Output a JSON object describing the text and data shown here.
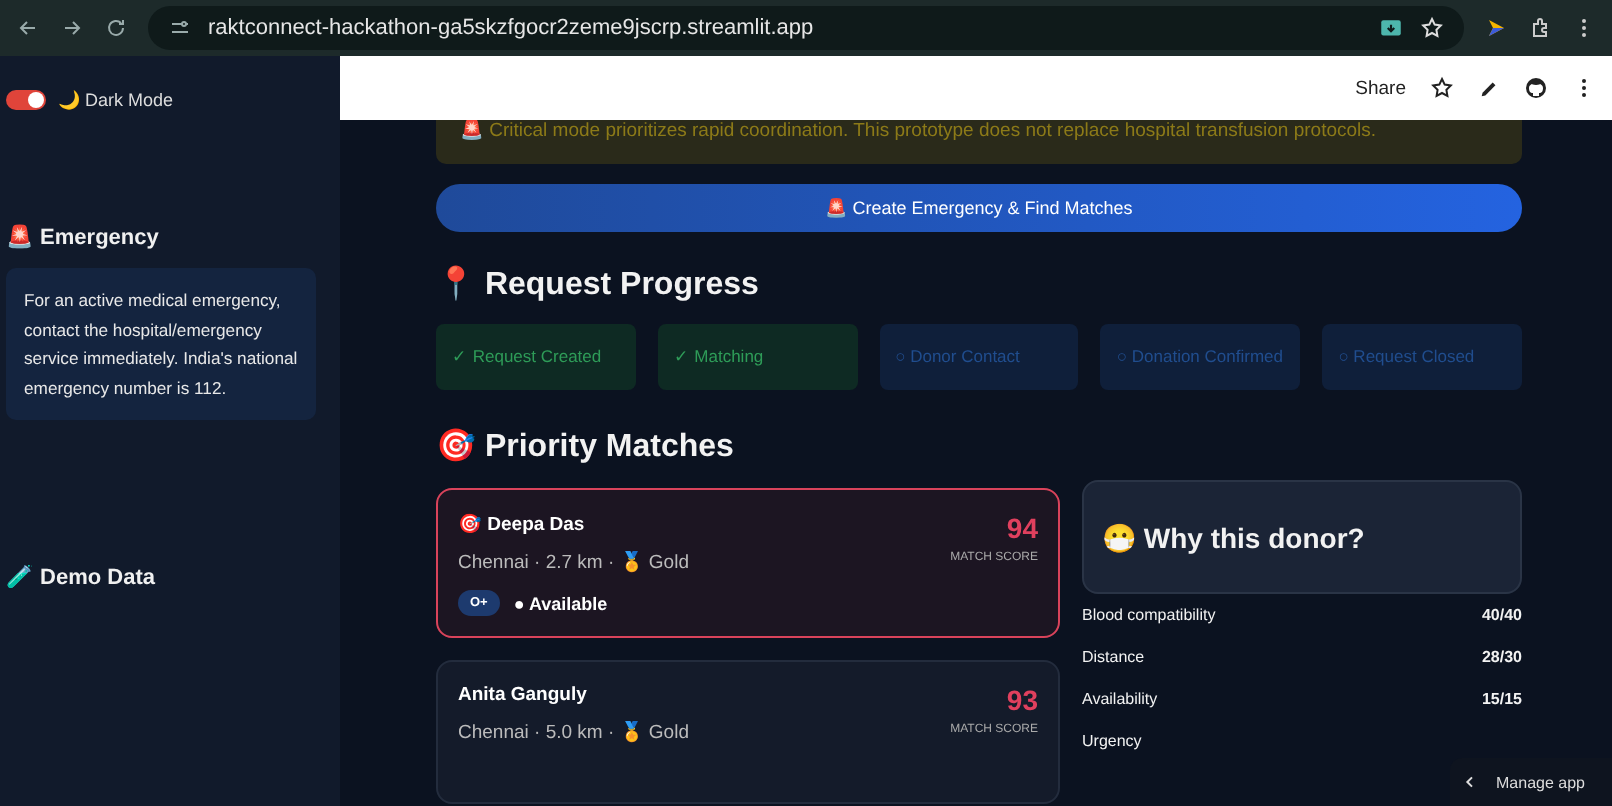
{
  "browser": {
    "url": "raktconnect-hackathon-ga5skzfgocr2zeme9jscrp.streamlit.app"
  },
  "sidebar": {
    "dark_mode": {
      "label": "🌙 Dark Mode",
      "on": true
    },
    "sections": [
      {
        "title": "🚨 Emergency",
        "note": "For an active medical emergency, contact the hospital/emergency service immediately. India's national emergency number is 112."
      },
      {
        "title": "🧪 Demo Data"
      }
    ]
  },
  "header": {
    "share": "Share"
  },
  "warning": "🚨 Critical mode prioritizes rapid coordination. This prototype does not replace hospital transfusion protocols.",
  "primary_button": "🚨 Create Emergency & Find Matches",
  "progress": {
    "title": "📍 Request Progress",
    "steps": [
      {
        "label": "✓ Request Created",
        "done": true
      },
      {
        "label": "✓ Matching",
        "done": true
      },
      {
        "label": "○ Donor Contact",
        "done": false
      },
      {
        "label": "○ Donation Confirmed",
        "done": false
      },
      {
        "label": "○ Request Closed",
        "done": false
      }
    ]
  },
  "matches": {
    "title": "🎯 Priority Matches",
    "donors": [
      {
        "name": "🎯 Deepa Das",
        "location": "Chennai · 2.7 km · 🏅 Gold",
        "score": "94",
        "score_label": "MATCH SCORE",
        "blood_group": "O+",
        "status": "● Available",
        "selected": true
      },
      {
        "name": "Anita Ganguly",
        "location": "Chennai · 5.0 km · 🏅 Gold",
        "score": "93",
        "score_label": "MATCH SCORE",
        "selected": false
      }
    ]
  },
  "why": {
    "title": "😷 Why this donor?",
    "rows": [
      {
        "label": "Blood compatibility",
        "value": "40/40"
      },
      {
        "label": "Distance",
        "value": "28/30"
      },
      {
        "label": "Availability",
        "value": "15/15"
      },
      {
        "label": "Urgency"
      }
    ]
  },
  "manage_app": {
    "label": "Manage app"
  }
}
